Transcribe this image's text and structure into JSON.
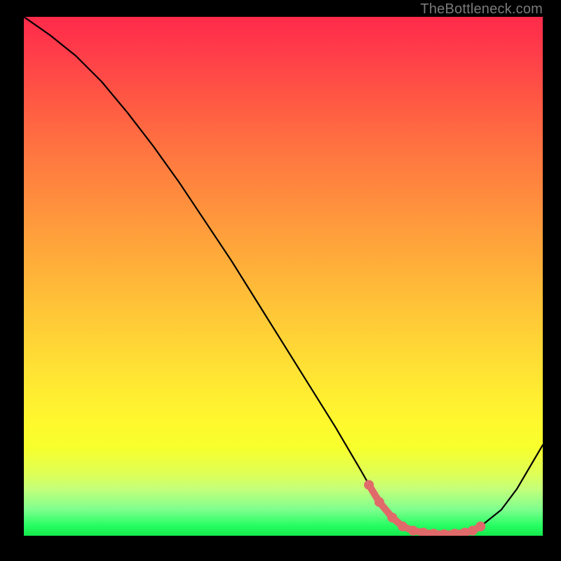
{
  "attribution": "TheBottleneck.com",
  "chart_data": {
    "type": "line",
    "title": "",
    "xlabel": "",
    "ylabel": "",
    "xlim": [
      0,
      100
    ],
    "ylim": [
      0,
      100
    ],
    "series": [
      {
        "name": "bottleneck-curve",
        "stroke": "#000000",
        "x": [
          0,
          5,
          10,
          15,
          20,
          25,
          30,
          35,
          40,
          45,
          50,
          55,
          60,
          65,
          67,
          70,
          73,
          76,
          79,
          82,
          85,
          88,
          92,
          95,
          100
        ],
        "y": [
          100,
          96.5,
          92.5,
          87.5,
          81.5,
          75.0,
          68.0,
          60.5,
          53.0,
          45.0,
          37.0,
          29.0,
          21.0,
          12.5,
          9.0,
          4.5,
          1.8,
          0.8,
          0.4,
          0.3,
          0.6,
          1.8,
          5.0,
          9.0,
          17.5
        ]
      },
      {
        "name": "optimal-zone-markers",
        "stroke": "#e06a6a",
        "marker_fill": "#e06a6a",
        "x": [
          66.5,
          68.5,
          71,
          73,
          75,
          77,
          79,
          81,
          83,
          85,
          86.5,
          88
        ],
        "y": [
          9.8,
          6.5,
          3.5,
          1.8,
          1.0,
          0.6,
          0.4,
          0.3,
          0.4,
          0.6,
          1.0,
          1.8
        ]
      }
    ],
    "gradient_stops": [
      {
        "pos": 0.0,
        "color": "#ff2a4a"
      },
      {
        "pos": 0.06,
        "color": "#ff3a4a"
      },
      {
        "pos": 0.15,
        "color": "#ff5544"
      },
      {
        "pos": 0.27,
        "color": "#ff7840"
      },
      {
        "pos": 0.4,
        "color": "#ff9a3c"
      },
      {
        "pos": 0.54,
        "color": "#ffbf38"
      },
      {
        "pos": 0.68,
        "color": "#ffe234"
      },
      {
        "pos": 0.78,
        "color": "#fff82e"
      },
      {
        "pos": 0.83,
        "color": "#f7ff2c"
      },
      {
        "pos": 0.88,
        "color": "#dfff56"
      },
      {
        "pos": 0.91,
        "color": "#c4ff7a"
      },
      {
        "pos": 0.95,
        "color": "#7dff8e"
      },
      {
        "pos": 0.98,
        "color": "#27fe62"
      },
      {
        "pos": 1.0,
        "color": "#14e84c"
      }
    ]
  }
}
